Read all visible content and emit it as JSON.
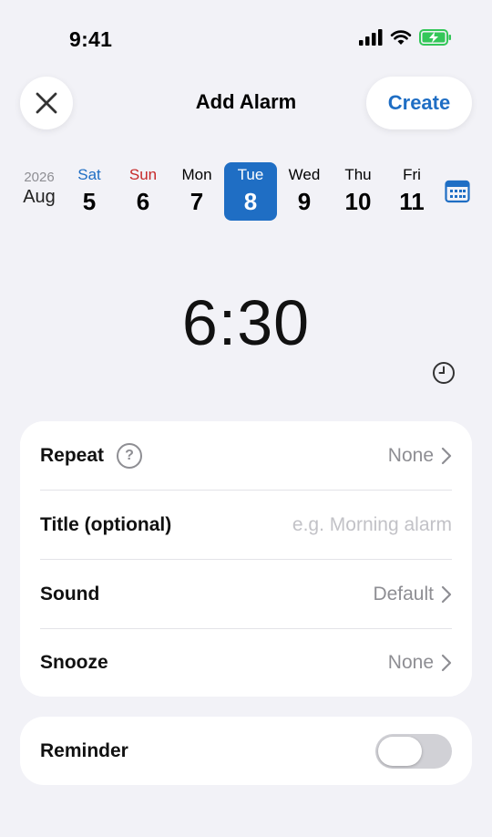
{
  "status": {
    "time": "9:41"
  },
  "nav": {
    "title": "Add Alarm",
    "create_label": "Create"
  },
  "date_strip": {
    "year": "2026",
    "month": "Aug",
    "days": [
      {
        "dow": "Sat",
        "num": "5",
        "color": "#1f6ec4",
        "selected": false
      },
      {
        "dow": "Sun",
        "num": "6",
        "color": "#c62828",
        "selected": false
      },
      {
        "dow": "Mon",
        "num": "7",
        "color": "#000000",
        "selected": false
      },
      {
        "dow": "Tue",
        "num": "8",
        "color": "#ffffff",
        "selected": true
      },
      {
        "dow": "Wed",
        "num": "9",
        "color": "#000000",
        "selected": false
      },
      {
        "dow": "Thu",
        "num": "10",
        "color": "#000000",
        "selected": false
      },
      {
        "dow": "Fri",
        "num": "11",
        "color": "#000000",
        "selected": false
      }
    ]
  },
  "alarm": {
    "time": "6:30"
  },
  "settings": {
    "repeat": {
      "label": "Repeat",
      "value": "None"
    },
    "title": {
      "label": "Title (optional)",
      "placeholder": "e.g. Morning alarm"
    },
    "sound": {
      "label": "Sound",
      "value": "Default"
    },
    "snooze": {
      "label": "Snooze",
      "value": "None"
    }
  },
  "reminder": {
    "label": "Reminder",
    "enabled": false
  },
  "colors": {
    "accent": "#1f6ec4",
    "background": "#f2f2f7"
  }
}
